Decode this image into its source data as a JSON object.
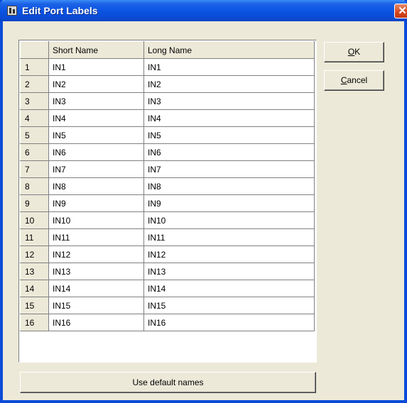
{
  "window": {
    "title": "Edit Port Labels",
    "close_glyph": "✕"
  },
  "grid": {
    "columns": [
      "",
      "Short Name",
      "Long Name"
    ],
    "rows": [
      {
        "num": "1",
        "short": "IN1",
        "long": "IN1"
      },
      {
        "num": "2",
        "short": "IN2",
        "long": "IN2"
      },
      {
        "num": "3",
        "short": "IN3",
        "long": "IN3"
      },
      {
        "num": "4",
        "short": "IN4",
        "long": "IN4"
      },
      {
        "num": "5",
        "short": "IN5",
        "long": "IN5"
      },
      {
        "num": "6",
        "short": "IN6",
        "long": "IN6"
      },
      {
        "num": "7",
        "short": "IN7",
        "long": "IN7"
      },
      {
        "num": "8",
        "short": "IN8",
        "long": "IN8"
      },
      {
        "num": "9",
        "short": "IN9",
        "long": "IN9"
      },
      {
        "num": "10",
        "short": "IN10",
        "long": "IN10"
      },
      {
        "num": "11",
        "short": "IN11",
        "long": "IN11"
      },
      {
        "num": "12",
        "short": "IN12",
        "long": "IN12"
      },
      {
        "num": "13",
        "short": "IN13",
        "long": "IN13"
      },
      {
        "num": "14",
        "short": "IN14",
        "long": "IN14"
      },
      {
        "num": "15",
        "short": "IN15",
        "long": "IN15"
      },
      {
        "num": "16",
        "short": "IN16",
        "long": "IN16"
      }
    ]
  },
  "buttons": {
    "ok_mnemonic": "O",
    "ok_rest": "K",
    "cancel_mnemonic": "C",
    "cancel_rest": "ancel",
    "default_names": "Use default names"
  },
  "colors": {
    "titlebar": "#0A4CD6",
    "dialog_bg": "#ECE9D8",
    "close_button": "#D6451B"
  }
}
